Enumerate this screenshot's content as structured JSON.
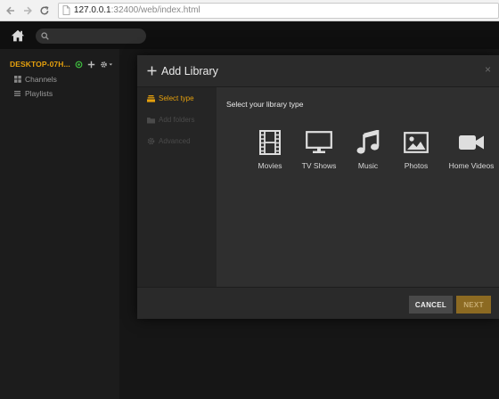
{
  "browser": {
    "url_host": "127.0.0.1",
    "url_path": ":32400/web/index.html"
  },
  "sidebar": {
    "server_name": "DESKTOP-07H...",
    "items": [
      {
        "label": "Channels",
        "icon": "grid-icon"
      },
      {
        "label": "Playlists",
        "icon": "list-icon"
      }
    ]
  },
  "modal": {
    "title": "Add Library",
    "close_label": "×",
    "steps": [
      {
        "label": "Select type",
        "state": "active"
      },
      {
        "label": "Add folders",
        "state": "disabled"
      },
      {
        "label": "Advanced",
        "state": "disabled"
      }
    ],
    "heading": "Select your library type",
    "library_types": [
      {
        "label": "Movies",
        "icon": "film-icon"
      },
      {
        "label": "TV Shows",
        "icon": "tv-icon"
      },
      {
        "label": "Music",
        "icon": "music-note-icon"
      },
      {
        "label": "Photos",
        "icon": "photo-icon"
      },
      {
        "label": "Home Videos",
        "icon": "video-camera-icon"
      }
    ],
    "cancel_label": "CANCEL",
    "next_label": "NEXT"
  },
  "colors": {
    "accent": "#e5a00d",
    "status_green": "#3fbd3f",
    "next_button": "#8c6a22"
  }
}
